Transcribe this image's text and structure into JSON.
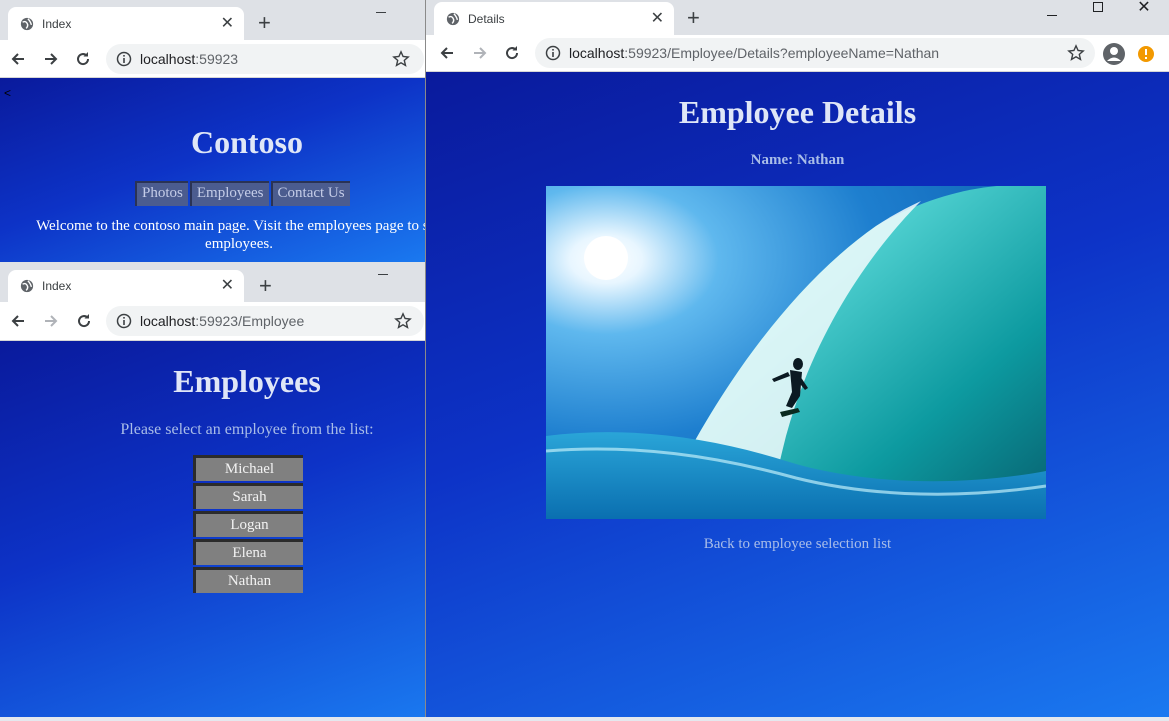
{
  "window_home": {
    "tab_title": "Index",
    "url_host": "localhost",
    "url_rest": ":59923",
    "corner_glyph": "<",
    "site_title": "Contoso",
    "nav": [
      "Photos",
      "Employees",
      "Contact Us"
    ],
    "welcome_text": "Welcome to the contoso main page. Visit the employees page to see employees."
  },
  "window_employees": {
    "tab_title": "Index",
    "url_host": "localhost",
    "url_rest": ":59923/Employee",
    "heading": "Employees",
    "prompt": "Please select an employee from the list:",
    "employees": [
      "Michael",
      "Sarah",
      "Logan",
      "Elena",
      "Nathan"
    ]
  },
  "window_details": {
    "tab_title": "Details",
    "url_host": "localhost",
    "url_rest": ":59923/Employee/Details?employeeName=Nathan",
    "heading": "Employee Details",
    "name_line": "Name: Nathan",
    "back_link": "Back to employee selection list"
  },
  "colors": {
    "tabstrip": "#dee1e6",
    "page_gradient_start": "#0a1a9c",
    "page_gradient_end": "#1a79f0",
    "nav_button": "#4b5c8f",
    "employee_button": "#808080",
    "link_text": "#a9bde8"
  },
  "icons": [
    "globe-icon",
    "close-icon",
    "new-tab-icon",
    "back-icon",
    "forward-icon",
    "reload-icon",
    "info-icon",
    "star-icon",
    "profile-icon",
    "alert-icon",
    "minimize-icon",
    "maximize-icon",
    "window-close-icon"
  ]
}
